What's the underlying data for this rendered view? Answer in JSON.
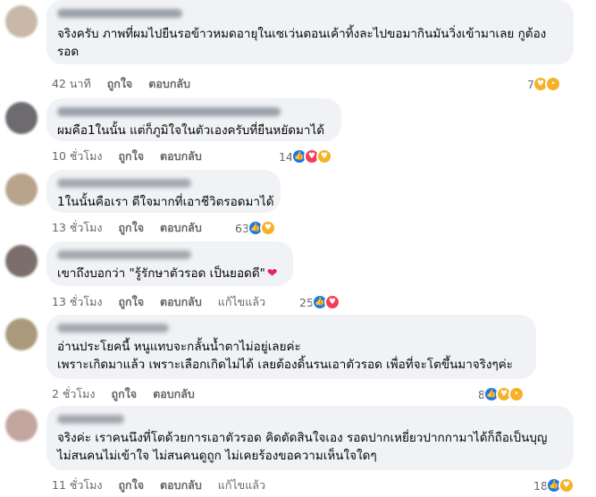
{
  "comments": [
    {
      "avatar_color": "#c9b8a8",
      "text_lines": [
        "จริงครับ ภาพที่ผมไปยืนรอข้าวหมดอายุในเซเว่นตอนเค้าทิ้งละไปขอมากินมันวิ่งเข้ามาเลย กูต้อง",
        "รอด"
      ],
      "time": "42 นาที",
      "like": "ถูกใจ",
      "reply": "ตอบกลับ",
      "reaction_count": "7",
      "reaction_icons": [
        "care-icon",
        "sad-icon"
      ]
    },
    {
      "avatar_color": "#6d6a70",
      "text_lines": [
        "ผมคือ1ในนั้น แต่ก็ภูมิใจในตัวเองครับที่ยืนหยัดมาได้"
      ],
      "time": "10 ชั่วโมง",
      "like": "ถูกใจ",
      "reply": "ตอบกลับ",
      "reaction_count": "14",
      "reaction_icons": [
        "like-icon",
        "love-icon",
        "care-icon"
      ]
    },
    {
      "avatar_color": "#b8a48c",
      "text_lines": [
        "1ในนั้นคือเรา ดีใจมากที่เอาชีวิตรอดมาได้"
      ],
      "time": "13 ชั่วโมง",
      "like": "ถูกใจ",
      "reply": "ตอบกลับ",
      "reaction_count": "63",
      "reaction_icons": [
        "like-icon",
        "care-icon"
      ]
    },
    {
      "avatar_color": "#7c6e6a",
      "text_lines": [
        "เขาถึงบอกว่า \"รู้รักษาตัวรอด เป็นยอดดี\""
      ],
      "heart": "❤",
      "time": "13 ชั่วโมง",
      "like": "ถูกใจ",
      "reply": "ตอบกลับ",
      "edited": "แก้ไขแล้ว",
      "reaction_count": "25",
      "reaction_icons": [
        "like-icon",
        "love-icon"
      ]
    },
    {
      "avatar_color": "#a89a7a",
      "text_lines": [
        "อ่านประโยคนี้ หนูแทบจะกลั้นน้ำตาไม่อยู่เลยค่ะ",
        "เพราะเกิดมาแล้ว เพราะเลือกเกิดไม่ได้ เลยต้องดิ้นรนเอาตัวรอด เพื่อที่จะโตขึ้นมาจริงๆค่ะ"
      ],
      "time": "2 ชั่วโมง",
      "like": "ถูกใจ",
      "reply": "ตอบกลับ",
      "reaction_count": "8",
      "reaction_icons": [
        "like-icon",
        "care-icon",
        "sad-icon"
      ]
    },
    {
      "avatar_color": "#c4a6a0",
      "text_lines": [
        "จริงค่ะ เราคนนึงที่โตด้วยการเอาตัวรอด คิดตัดสินใจเอง รอดปากเหยี่ยวปากกามาได้ก็ถือเป็นบุญ",
        "ไม่สนคนไม่เข้าใจ ไม่สนคนดูถูก ไม่เคยร้องขอความเห็นใจใดๆ"
      ],
      "time": "11 ชั่วโมง",
      "like": "ถูกใจ",
      "reply": "ตอบกลับ",
      "edited": "แก้ไขแล้ว",
      "reaction_count": "18",
      "reaction_icons": [
        "like-icon",
        "care-icon"
      ]
    }
  ]
}
